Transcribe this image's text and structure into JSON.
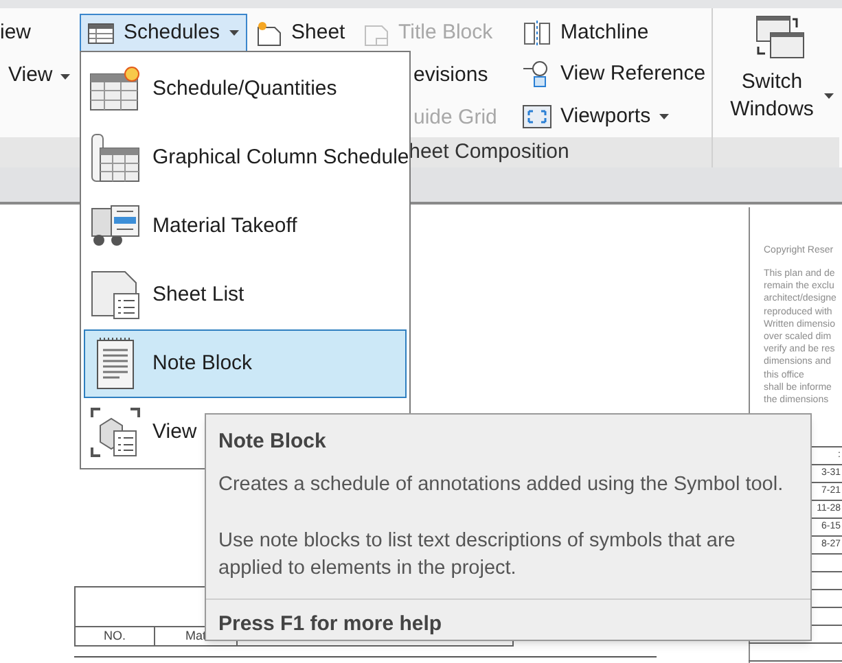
{
  "ribbon": {
    "left_buttons": [
      {
        "label": "iew",
        "dropdown": false
      },
      {
        "label": "View",
        "dropdown": true
      }
    ],
    "schedules": {
      "label": "Schedules",
      "selected": true,
      "dropdown": true
    },
    "sheet_buttons": [
      {
        "label": "Sheet",
        "disabled": false
      },
      {
        "label": "Title Block",
        "disabled": true
      },
      {
        "label": "evisions",
        "disabled": false
      },
      {
        "label": "uide Grid",
        "disabled": true
      }
    ],
    "reference_buttons": [
      {
        "label": "Matchline",
        "dropdown": false
      },
      {
        "label": "View Reference",
        "dropdown": false
      },
      {
        "label": "Viewports",
        "dropdown": true
      }
    ],
    "switch_windows": {
      "label": "Switch Windows",
      "dropdown": true
    },
    "panel_label": "heet Composition"
  },
  "menu": {
    "items": [
      {
        "kind": "schedule",
        "label": "Schedule/Quantities",
        "selected": false
      },
      {
        "kind": "column",
        "label": "Graphical Column Schedule",
        "selected": false
      },
      {
        "kind": "takeoff",
        "label": "Material Takeoff",
        "selected": false
      },
      {
        "kind": "sheetlist",
        "label": "Sheet List",
        "selected": false
      },
      {
        "kind": "note",
        "label": "Note Block",
        "selected": true
      },
      {
        "kind": "viewlist",
        "label": "View",
        "selected": false
      }
    ]
  },
  "tooltip": {
    "title": "Note Block",
    "paragraphs": [
      "Creates a schedule of annotations added using the Symbol tool.",
      "Use note blocks to list text descriptions of symbols that are applied to elements in the project."
    ],
    "footer": "Press F1 for more help"
  },
  "sheet": {
    "notes_title": "Copyright Reser",
    "notes": [
      "This plan and de",
      "remain the exclu",
      "architect/designe",
      "reproduced with",
      "Written dimensio",
      "over scaled dim",
      "verify and be res",
      "dimensions and",
      "this office",
      "shall be informe",
      "the dimensions"
    ],
    "revision_dates": [
      ":",
      "3-31",
      "7-21",
      "11-28",
      "6-15",
      "8-27"
    ],
    "table_headers": [
      "NO.",
      "Mat"
    ]
  }
}
